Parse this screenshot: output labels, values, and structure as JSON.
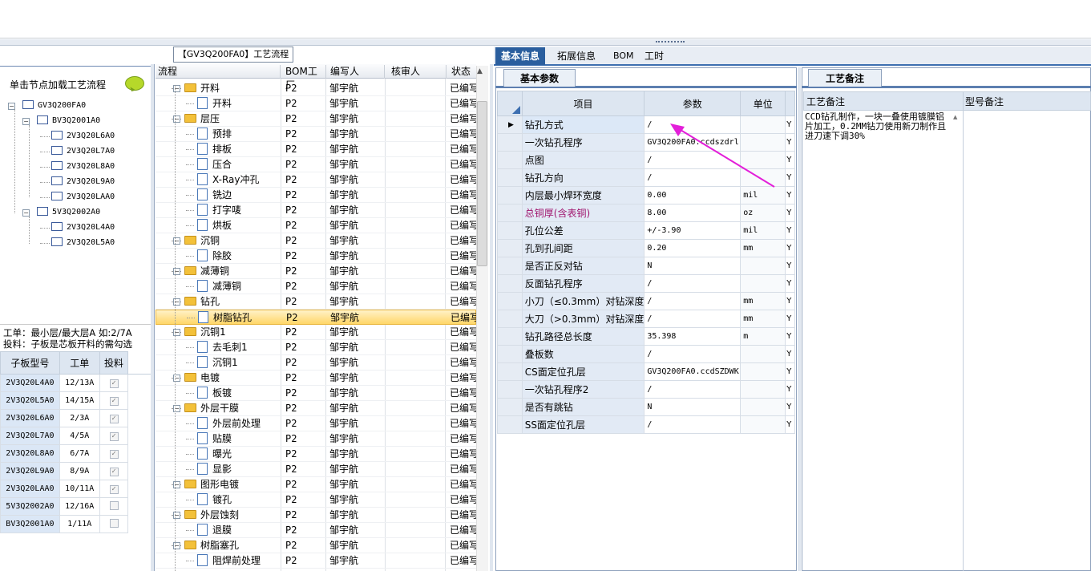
{
  "left": {
    "header": "单击节点加载工艺流程",
    "tree": [
      {
        "label": "GV3Q200FA0",
        "level": 0,
        "expander": "−"
      },
      {
        "label": "BV3Q2001A0",
        "level": 1,
        "expander": "−"
      },
      {
        "label": "2V3Q20L6A0",
        "level": 2
      },
      {
        "label": "2V3Q20L7A0",
        "level": 2
      },
      {
        "label": "2V3Q20L8A0",
        "level": 2
      },
      {
        "label": "2V3Q20L9A0",
        "level": 2
      },
      {
        "label": "2V3Q20LAA0",
        "level": 2
      },
      {
        "label": "5V3Q2002A0",
        "level": 1,
        "expander": "−"
      },
      {
        "label": "2V3Q20L4A0",
        "level": 2
      },
      {
        "label": "2V3Q20L5A0",
        "level": 2
      }
    ],
    "info_line1": "工单：最小层/最大层A 如:2/7A",
    "info_line2": "投料：子板是芯板开料的需勾选",
    "table_headers": [
      "子板型号",
      "工单",
      "投料"
    ],
    "table_rows": [
      {
        "model": "2V3Q20L4A0",
        "order": "12/13A",
        "feed": true
      },
      {
        "model": "2V3Q20L5A0",
        "order": "14/15A",
        "feed": true
      },
      {
        "model": "2V3Q20L6A0",
        "order": "2/3A",
        "feed": true
      },
      {
        "model": "2V3Q20L7A0",
        "order": "4/5A",
        "feed": true
      },
      {
        "model": "2V3Q20L8A0",
        "order": "6/7A",
        "feed": true
      },
      {
        "model": "2V3Q20L9A0",
        "order": "8/9A",
        "feed": true
      },
      {
        "model": "2V3Q20LAA0",
        "order": "10/11A",
        "feed": true
      },
      {
        "model": "5V3Q2002A0",
        "order": "12/16A",
        "feed": false
      },
      {
        "model": "BV3Q2001A0",
        "order": "1/11A",
        "feed": false
      }
    ]
  },
  "middle": {
    "title": "【GV3Q200FA0】工艺流程",
    "headers": [
      "流程",
      "BOM工厂",
      "编写人",
      "核审人",
      "状态"
    ],
    "rows": [
      {
        "name": "开料",
        "type": "folder",
        "bom": "P2",
        "writer": "邹宇航",
        "status": "已编写"
      },
      {
        "name": "开料",
        "type": "doc",
        "bom": "P2",
        "writer": "邹宇航",
        "status": "已编写"
      },
      {
        "name": "层压",
        "type": "folder",
        "bom": "P2",
        "writer": "邹宇航",
        "status": "已编写"
      },
      {
        "name": "预排",
        "type": "doc",
        "bom": "P2",
        "writer": "邹宇航",
        "status": "已编写"
      },
      {
        "name": "排板",
        "type": "doc",
        "bom": "P2",
        "writer": "邹宇航",
        "status": "已编写"
      },
      {
        "name": "压合",
        "type": "doc",
        "bom": "P2",
        "writer": "邹宇航",
        "status": "已编写"
      },
      {
        "name": "X-Ray冲孔",
        "type": "doc",
        "bom": "P2",
        "writer": "邹宇航",
        "status": "已编写"
      },
      {
        "name": "铣边",
        "type": "doc",
        "bom": "P2",
        "writer": "邹宇航",
        "status": "已编写"
      },
      {
        "name": "打字唛",
        "type": "doc",
        "bom": "P2",
        "writer": "邹宇航",
        "status": "已编写"
      },
      {
        "name": "烘板",
        "type": "doc",
        "bom": "P2",
        "writer": "邹宇航",
        "status": "已编写"
      },
      {
        "name": "沉铜",
        "type": "folder",
        "bom": "P2",
        "writer": "邹宇航",
        "status": "已编写"
      },
      {
        "name": "除胶",
        "type": "doc",
        "bom": "P2",
        "writer": "邹宇航",
        "status": "已编写"
      },
      {
        "name": "减薄铜",
        "type": "folder",
        "bom": "P2",
        "writer": "邹宇航",
        "status": "已编写"
      },
      {
        "name": "减薄铜",
        "type": "doc",
        "bom": "P2",
        "writer": "邹宇航",
        "status": "已编写"
      },
      {
        "name": "钻孔",
        "type": "folder",
        "bom": "P2",
        "writer": "邹宇航",
        "status": "已编写"
      },
      {
        "name": "树脂钻孔",
        "type": "doc",
        "bom": "P2",
        "writer": "邹宇航",
        "status": "已编写",
        "selected": true
      },
      {
        "name": "沉铜1",
        "type": "folder",
        "bom": "P2",
        "writer": "邹宇航",
        "status": "已编写"
      },
      {
        "name": "去毛刺1",
        "type": "doc",
        "bom": "P2",
        "writer": "邹宇航",
        "status": "已编写"
      },
      {
        "name": "沉铜1",
        "type": "doc",
        "bom": "P2",
        "writer": "邹宇航",
        "status": "已编写"
      },
      {
        "name": "电镀",
        "type": "folder",
        "bom": "P2",
        "writer": "邹宇航",
        "status": "已编写"
      },
      {
        "name": "板镀",
        "type": "doc",
        "bom": "P2",
        "writer": "邹宇航",
        "status": "已编写"
      },
      {
        "name": "外层干膜",
        "type": "folder",
        "bom": "P2",
        "writer": "邹宇航",
        "status": "已编写"
      },
      {
        "name": "外层前处理",
        "type": "doc",
        "bom": "P2",
        "writer": "邹宇航",
        "status": "已编写"
      },
      {
        "name": "贴膜",
        "type": "doc",
        "bom": "P2",
        "writer": "邹宇航",
        "status": "已编写"
      },
      {
        "name": "曝光",
        "type": "doc",
        "bom": "P2",
        "writer": "邹宇航",
        "status": "已编写"
      },
      {
        "name": "显影",
        "type": "doc",
        "bom": "P2",
        "writer": "邹宇航",
        "status": "已编写"
      },
      {
        "name": "图形电镀",
        "type": "folder",
        "bom": "P2",
        "writer": "邹宇航",
        "status": "已编写"
      },
      {
        "name": "镀孔",
        "type": "doc",
        "bom": "P2",
        "writer": "邹宇航",
        "status": "已编写"
      },
      {
        "name": "外层蚀刻",
        "type": "folder",
        "bom": "P2",
        "writer": "邹宇航",
        "status": "已编写"
      },
      {
        "name": "退膜",
        "type": "doc",
        "bom": "P2",
        "writer": "邹宇航",
        "status": "已编写"
      },
      {
        "name": "树脂塞孔",
        "type": "folder",
        "bom": "P2",
        "writer": "邹宇航",
        "status": "已编写"
      },
      {
        "name": "阻焊前处理",
        "type": "doc",
        "bom": "P2",
        "writer": "邹宇航",
        "status": "已编写"
      }
    ]
  },
  "right": {
    "tabs": [
      "基本信息",
      "拓展信息",
      "BOM",
      "工时"
    ],
    "basic_tab": "基本参数",
    "param_headers": [
      "项目",
      "参数",
      "单位"
    ],
    "params": [
      {
        "item": "钻孔方式",
        "value": "/",
        "unit": "",
        "flag": "Y",
        "current": true
      },
      {
        "item": "一次钻孔程序",
        "value": "GV3Q200FA0.ccdszdrl",
        "unit": "",
        "flag": "Y"
      },
      {
        "item": "点图",
        "value": "/",
        "unit": "",
        "flag": "Y"
      },
      {
        "item": "钻孔方向",
        "value": "/",
        "unit": "",
        "flag": "Y"
      },
      {
        "item": "内层最小焊环宽度",
        "value": "0.00",
        "unit": "mil",
        "flag": "Y"
      },
      {
        "item": "总铜厚(含表铜)",
        "value": "8.00",
        "unit": "oz",
        "flag": "Y",
        "highlight": true
      },
      {
        "item": "孔位公差",
        "value": "+/-3.90",
        "unit": "mil",
        "flag": "Y"
      },
      {
        "item": "孔到孔间距",
        "value": "0.20",
        "unit": "mm",
        "flag": "Y"
      },
      {
        "item": "是否正反对钻",
        "value": "N",
        "unit": "",
        "flag": "Y"
      },
      {
        "item": "反面钻孔程序",
        "value": "/",
        "unit": "",
        "flag": "Y"
      },
      {
        "item": "小刀（≤0.3mm）对钻深度",
        "value": "/",
        "unit": "mm",
        "flag": "Y"
      },
      {
        "item": "大刀（>0.3mm）对钻深度",
        "value": "/",
        "unit": "mm",
        "flag": "Y"
      },
      {
        "item": "钻孔路径总长度",
        "value": "35.398",
        "unit": "m",
        "flag": "Y"
      },
      {
        "item": "叠板数",
        "value": "/",
        "unit": "",
        "flag": "Y"
      },
      {
        "item": "CS面定位孔层",
        "value": "GV3Q200FA0.ccdSZDWK",
        "unit": "",
        "flag": "Y"
      },
      {
        "item": "一次钻孔程序2",
        "value": "/",
        "unit": "",
        "flag": "Y"
      },
      {
        "item": "是否有跳钻",
        "value": "N",
        "unit": "",
        "flag": "Y"
      },
      {
        "item": "SS面定位孔层",
        "value": "/",
        "unit": "",
        "flag": "Y"
      }
    ],
    "notes_tab": "工艺备注",
    "notes_headers": [
      "工艺备注",
      "型号备注"
    ],
    "note_text": "CCD钻孔制作，一块一叠使用镀膜铝片加工，0.2MM钻刀使用新刀制作且进刀速下调30%",
    "highlight_color": "#a0156e",
    "arrow_color": "#e31fd9"
  }
}
